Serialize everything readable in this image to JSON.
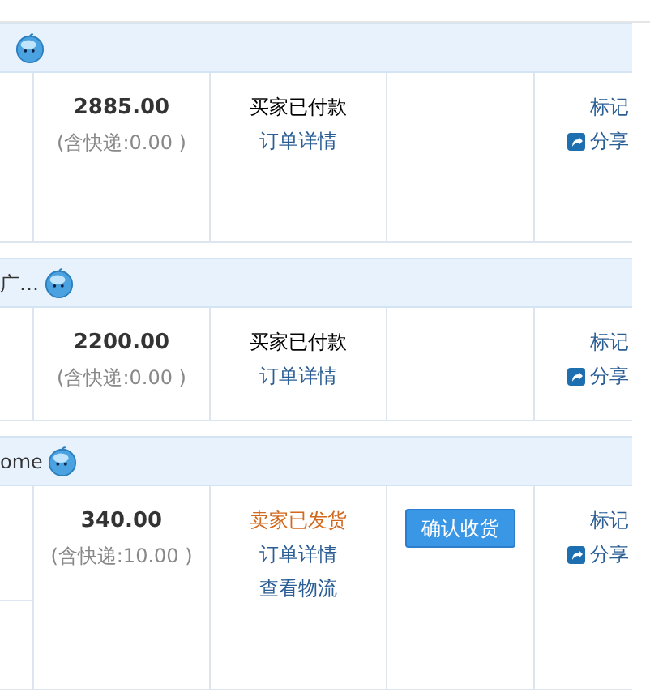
{
  "orders": [
    {
      "amount": "2885.00",
      "shipping": "(含快递:0.00 )",
      "status": {
        "text": "买家已付款",
        "color": "#000000"
      },
      "links": [
        "订单详情"
      ],
      "mark": "标记",
      "share": "分享"
    },
    {
      "shop_name": "广…",
      "amount": "2200.00",
      "shipping": "(含快递:0.00 )",
      "status": {
        "text": "买家已付款",
        "color": "#000000"
      },
      "links": [
        "订单详情"
      ],
      "mark": "标记",
      "share": "分享"
    },
    {
      "shop_name": "ome",
      "amount": "340.00",
      "shipping": "(含快递:10.00 )",
      "status": {
        "text": "卖家已发货",
        "color": "#d2691e"
      },
      "links": [
        "订单详情",
        "查看物流"
      ],
      "action": "确认收货",
      "mark": "标记",
      "share": "分享"
    }
  ]
}
